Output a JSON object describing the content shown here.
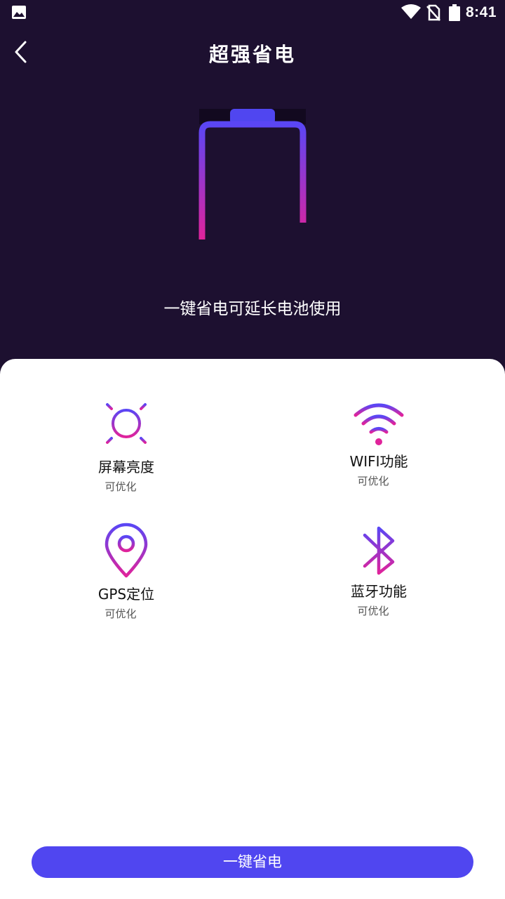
{
  "status_bar": {
    "time": "8:41"
  },
  "header": {
    "title": "超强省电"
  },
  "hero": {
    "description": "一键省电可延长电池使用"
  },
  "features": [
    {
      "label": "屏幕亮度",
      "status": "可优化",
      "icon": "sun-icon"
    },
    {
      "label": "WIFI功能",
      "status": "可优化",
      "icon": "wifi-icon"
    },
    {
      "label": "GPS定位",
      "status": "可优化",
      "icon": "location-pin-icon"
    },
    {
      "label": "蓝牙功能",
      "status": "可优化",
      "icon": "bluetooth-icon"
    }
  ],
  "action": {
    "button_label": "一键省电"
  },
  "colors": {
    "background": "#1d1030",
    "accent": "#5046f0",
    "gradient_start": "#5a46f5",
    "gradient_end": "#e0239b"
  }
}
